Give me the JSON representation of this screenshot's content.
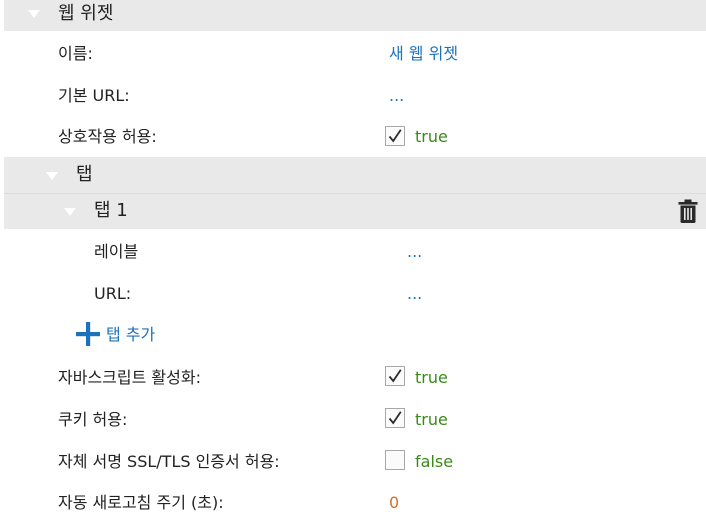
{
  "sections": {
    "web_widget": {
      "title": "웹 위젯"
    },
    "tabs": {
      "title": "탭"
    },
    "tab1": {
      "title": "탭 1"
    }
  },
  "fields": {
    "name": {
      "label": "이름:",
      "value": "새 웹 위젯"
    },
    "base_url": {
      "label": "기본 URL:",
      "value": "..."
    },
    "allow_interaction": {
      "label": "상호작용 허용:",
      "value": "true",
      "checked": true
    },
    "tab_label": {
      "label": "레이블",
      "value": "..."
    },
    "tab_url": {
      "label": "URL:",
      "value": "..."
    },
    "enable_javascript": {
      "label": "자바스크립트 활성화:",
      "value": "true",
      "checked": true
    },
    "allow_cookies": {
      "label": "쿠키 허용:",
      "value": "true",
      "checked": true
    },
    "allow_self_signed": {
      "label": "자체 서명 SSL/TLS 인증서 허용:",
      "value": "false",
      "checked": false
    },
    "auto_refresh": {
      "label": "자동 새로고침 주기 (초):",
      "value": "0"
    }
  },
  "actions": {
    "add_tab": "탭 추가"
  },
  "icons": {
    "expand": "triangle-down-icon",
    "delete": "trash-icon",
    "add": "plus-icon",
    "check": "checkmark-icon"
  },
  "colors": {
    "link": "#1e72bd",
    "true_value": "#3a8a17",
    "number_value": "#d1722b",
    "section_band": "#e9e9e9"
  }
}
